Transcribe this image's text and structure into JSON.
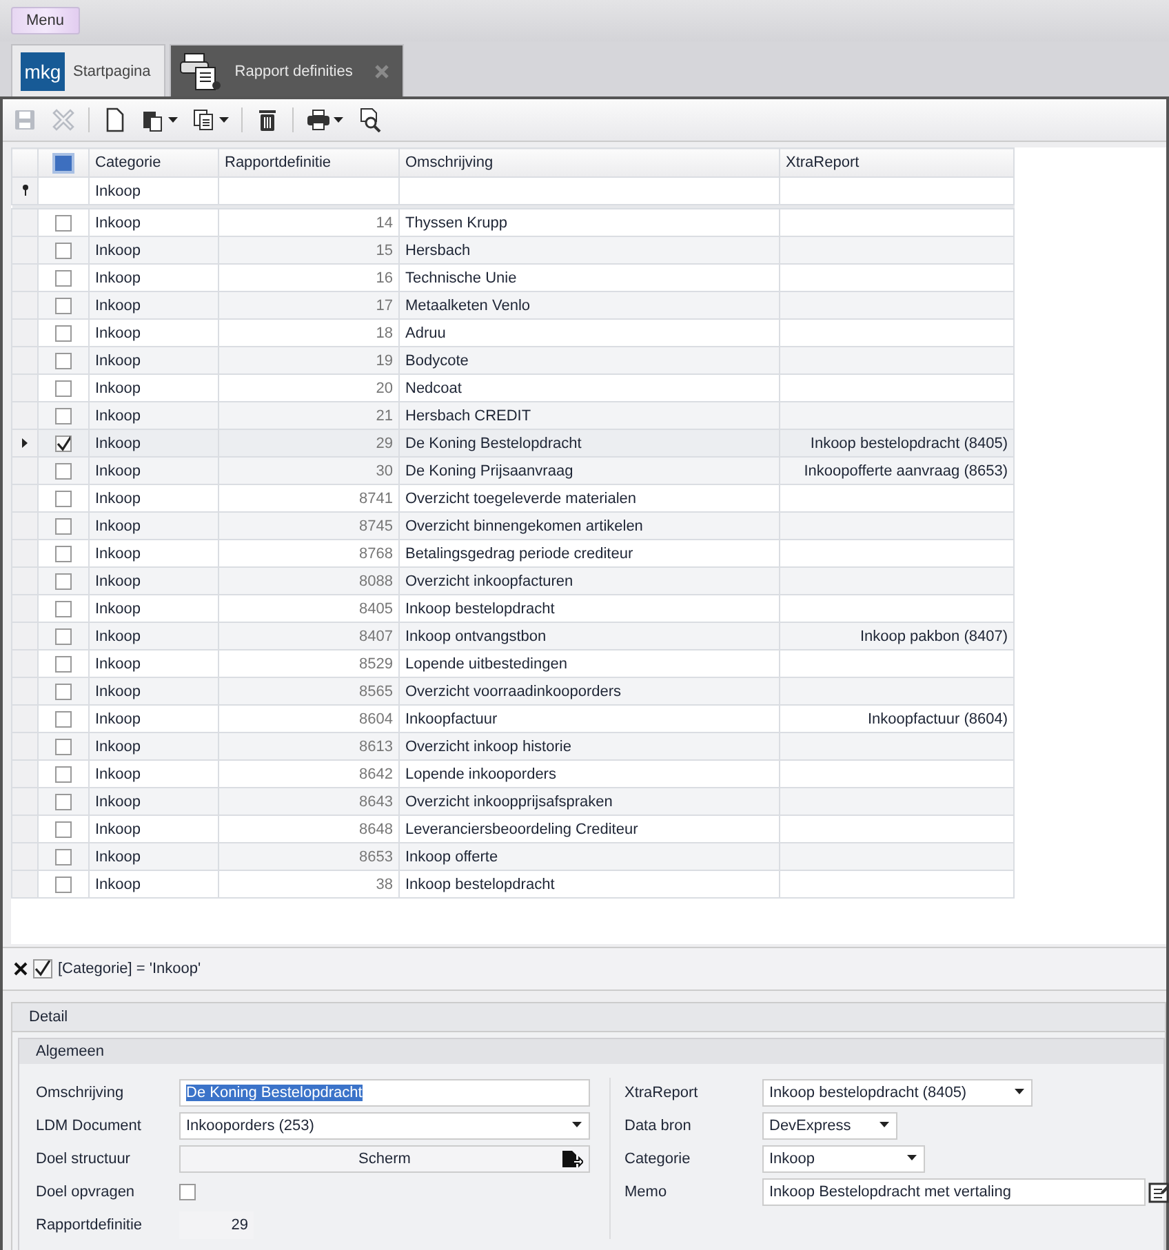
{
  "menu_button": "Menu",
  "tabs": [
    {
      "label": "Startpagina",
      "logo": "mkg",
      "selected": false,
      "closable": false
    },
    {
      "label": "Rapport definities",
      "selected": true,
      "closable": true
    }
  ],
  "toolbar": [
    {
      "kind": "save",
      "disabled": true
    },
    {
      "kind": "cancel",
      "disabled": true
    },
    {
      "kind": "new",
      "disabled": false
    },
    {
      "kind": "paste",
      "disabled": false,
      "dropdown": true
    },
    {
      "kind": "copy",
      "disabled": false,
      "dropdown": true
    },
    {
      "kind": "delete",
      "disabled": false
    },
    {
      "kind": "print",
      "disabled": false,
      "dropdown": true
    },
    {
      "kind": "preview",
      "disabled": false
    }
  ],
  "table": {
    "columns": [
      "Categorie",
      "Rapportdefinitie",
      "Omschrijving",
      "XtraReport"
    ],
    "select_all_partial": true,
    "filter_row": {
      "categorie": "Inkoop"
    },
    "rows": [
      {
        "categorie": "Inkoop",
        "rapportdefinitie": "14",
        "omschrijving": "Thyssen Krupp",
        "xtrareport": "",
        "checked": false,
        "selected": false
      },
      {
        "categorie": "Inkoop",
        "rapportdefinitie": "15",
        "omschrijving": "Hersbach",
        "xtrareport": "",
        "checked": false,
        "selected": false
      },
      {
        "categorie": "Inkoop",
        "rapportdefinitie": "16",
        "omschrijving": "Technische Unie",
        "xtrareport": "",
        "checked": false,
        "selected": false
      },
      {
        "categorie": "Inkoop",
        "rapportdefinitie": "17",
        "omschrijving": "Metaalketen Venlo",
        "xtrareport": "",
        "checked": false,
        "selected": false
      },
      {
        "categorie": "Inkoop",
        "rapportdefinitie": "18",
        "omschrijving": "Adruu",
        "xtrareport": "",
        "checked": false,
        "selected": false
      },
      {
        "categorie": "Inkoop",
        "rapportdefinitie": "19",
        "omschrijving": "Bodycote",
        "xtrareport": "",
        "checked": false,
        "selected": false
      },
      {
        "categorie": "Inkoop",
        "rapportdefinitie": "20",
        "omschrijving": "Nedcoat",
        "xtrareport": "",
        "checked": false,
        "selected": false
      },
      {
        "categorie": "Inkoop",
        "rapportdefinitie": "21",
        "omschrijving": "Hersbach CREDIT",
        "xtrareport": "",
        "checked": false,
        "selected": false
      },
      {
        "categorie": "Inkoop",
        "rapportdefinitie": "29",
        "omschrijving": "De Koning Bestelopdracht",
        "xtrareport": "Inkoop bestelopdracht (8405)",
        "checked": true,
        "selected": true
      },
      {
        "categorie": "Inkoop",
        "rapportdefinitie": "30",
        "omschrijving": "De Koning Prijsaanvraag",
        "xtrareport": "Inkoopofferte aanvraag (8653)",
        "checked": false,
        "selected": false
      },
      {
        "categorie": "Inkoop",
        "rapportdefinitie": "8741",
        "omschrijving": "Overzicht toegeleverde materialen",
        "xtrareport": "",
        "checked": false,
        "selected": false
      },
      {
        "categorie": "Inkoop",
        "rapportdefinitie": "8745",
        "omschrijving": "Overzicht binnengekomen artikelen",
        "xtrareport": "",
        "checked": false,
        "selected": false
      },
      {
        "categorie": "Inkoop",
        "rapportdefinitie": "8768",
        "omschrijving": "Betalingsgedrag periode crediteur",
        "xtrareport": "",
        "checked": false,
        "selected": false
      },
      {
        "categorie": "Inkoop",
        "rapportdefinitie": "8088",
        "omschrijving": "Overzicht inkoopfacturen",
        "xtrareport": "",
        "checked": false,
        "selected": false
      },
      {
        "categorie": "Inkoop",
        "rapportdefinitie": "8405",
        "omschrijving": "Inkoop bestelopdracht",
        "xtrareport": "",
        "checked": false,
        "selected": false
      },
      {
        "categorie": "Inkoop",
        "rapportdefinitie": "8407",
        "omschrijving": "Inkoop ontvangstbon",
        "xtrareport": "Inkoop pakbon (8407)",
        "checked": false,
        "selected": false
      },
      {
        "categorie": "Inkoop",
        "rapportdefinitie": "8529",
        "omschrijving": "Lopende uitbestedingen",
        "xtrareport": "",
        "checked": false,
        "selected": false
      },
      {
        "categorie": "Inkoop",
        "rapportdefinitie": "8565",
        "omschrijving": "Overzicht voorraadinkooporders",
        "xtrareport": "",
        "checked": false,
        "selected": false
      },
      {
        "categorie": "Inkoop",
        "rapportdefinitie": "8604",
        "omschrijving": "Inkoopfactuur",
        "xtrareport": "Inkoopfactuur (8604)",
        "checked": false,
        "selected": false
      },
      {
        "categorie": "Inkoop",
        "rapportdefinitie": "8613",
        "omschrijving": "Overzicht inkoop historie",
        "xtrareport": "",
        "checked": false,
        "selected": false
      },
      {
        "categorie": "Inkoop",
        "rapportdefinitie": "8642",
        "omschrijving": "Lopende inkooporders",
        "xtrareport": "",
        "checked": false,
        "selected": false
      },
      {
        "categorie": "Inkoop",
        "rapportdefinitie": "8643",
        "omschrijving": "Overzicht inkoopprijsafspraken",
        "xtrareport": "",
        "checked": false,
        "selected": false
      },
      {
        "categorie": "Inkoop",
        "rapportdefinitie": "8648",
        "omschrijving": "Leveranciersbeoordeling Crediteur",
        "xtrareport": "",
        "checked": false,
        "selected": false
      },
      {
        "categorie": "Inkoop",
        "rapportdefinitie": "8653",
        "omschrijving": "Inkoop offerte",
        "xtrareport": "",
        "checked": false,
        "selected": false
      },
      {
        "categorie": "Inkoop",
        "rapportdefinitie": "38",
        "omschrijving": "Inkoop bestelopdracht",
        "xtrareport": "",
        "checked": false,
        "selected": false
      }
    ]
  },
  "filter_bar": {
    "enabled": true,
    "expression": "[Categorie] = 'Inkoop'"
  },
  "detail": {
    "title": "Detail",
    "group": "Algemeen",
    "left_fields": [
      {
        "kind": "text",
        "label": "Omschrijving",
        "value": "De Koning Bestelopdracht",
        "highlighted": true
      },
      {
        "kind": "dropdown",
        "label": "LDM Document",
        "value": "Inkooporders (253)"
      },
      {
        "kind": "button",
        "label": "Doel structuur",
        "value": "Scherm"
      },
      {
        "kind": "checkbox",
        "label": "Doel opvragen",
        "checked": false
      },
      {
        "kind": "number",
        "label": "Rapportdefinitie",
        "value": "29"
      }
    ],
    "right_fields": [
      {
        "kind": "dropdown",
        "label": "XtraReport",
        "value": "Inkoop bestelopdracht (8405)"
      },
      {
        "kind": "dropdown",
        "label": "Data bron",
        "value": "DevExpress"
      },
      {
        "kind": "dropdown",
        "label": "Categorie",
        "value": "Inkoop"
      },
      {
        "kind": "memo",
        "label": "Memo",
        "value": "Inkoop Bestelopdracht met vertaling"
      }
    ]
  }
}
